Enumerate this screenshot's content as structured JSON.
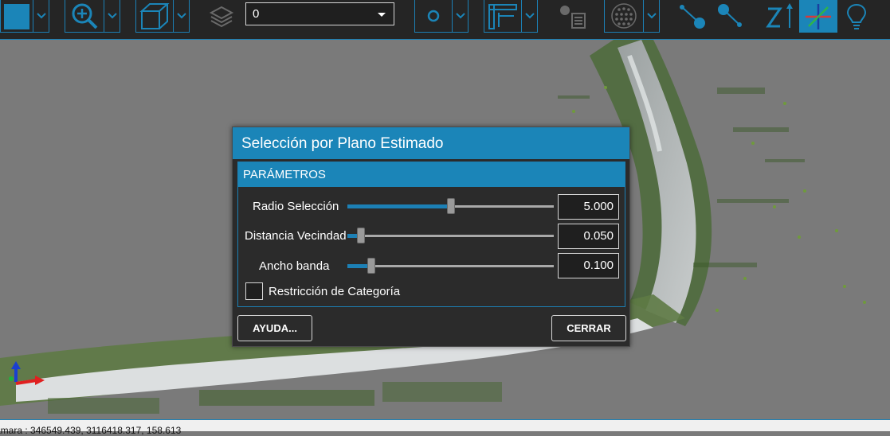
{
  "toolbar": {
    "layer_select": {
      "value": "0"
    },
    "icons": [
      "select-box-icon",
      "zoom-in-icon",
      "view-cube-icon",
      "layers-icon",
      "point-icon",
      "measure-ruler-icon",
      "point-table-icon",
      "point-cloud-icon",
      "connect-points-icon",
      "connect-points-2-icon",
      "z-axis-icon",
      "axis-crosshair-icon",
      "lightbulb-icon"
    ]
  },
  "dialog": {
    "title": "Selección por Plano Estimado",
    "section_title": "PARÁMETROS",
    "params": [
      {
        "label": "Radio Selección",
        "value": "5.000",
        "fraction": 0.5
      },
      {
        "label": "Distancia Vecindad",
        "value": "0.050",
        "fraction": 0.05
      },
      {
        "label": "Ancho banda",
        "value": "0.100",
        "fraction": 0.1
      }
    ],
    "checkbox": {
      "label": "Restricción de Categoría",
      "checked": false
    },
    "help_button": "AYUDA...",
    "close_button": "CERRAR"
  },
  "status": {
    "camera_text": "ámara : 346549.439, 3116418.317, 158.613"
  },
  "colors": {
    "accent": "#1b85b8",
    "toolbar_bg": "#252525",
    "viewport_bg": "#7a7a7a",
    "dialog_bg": "#2b2b2b"
  }
}
